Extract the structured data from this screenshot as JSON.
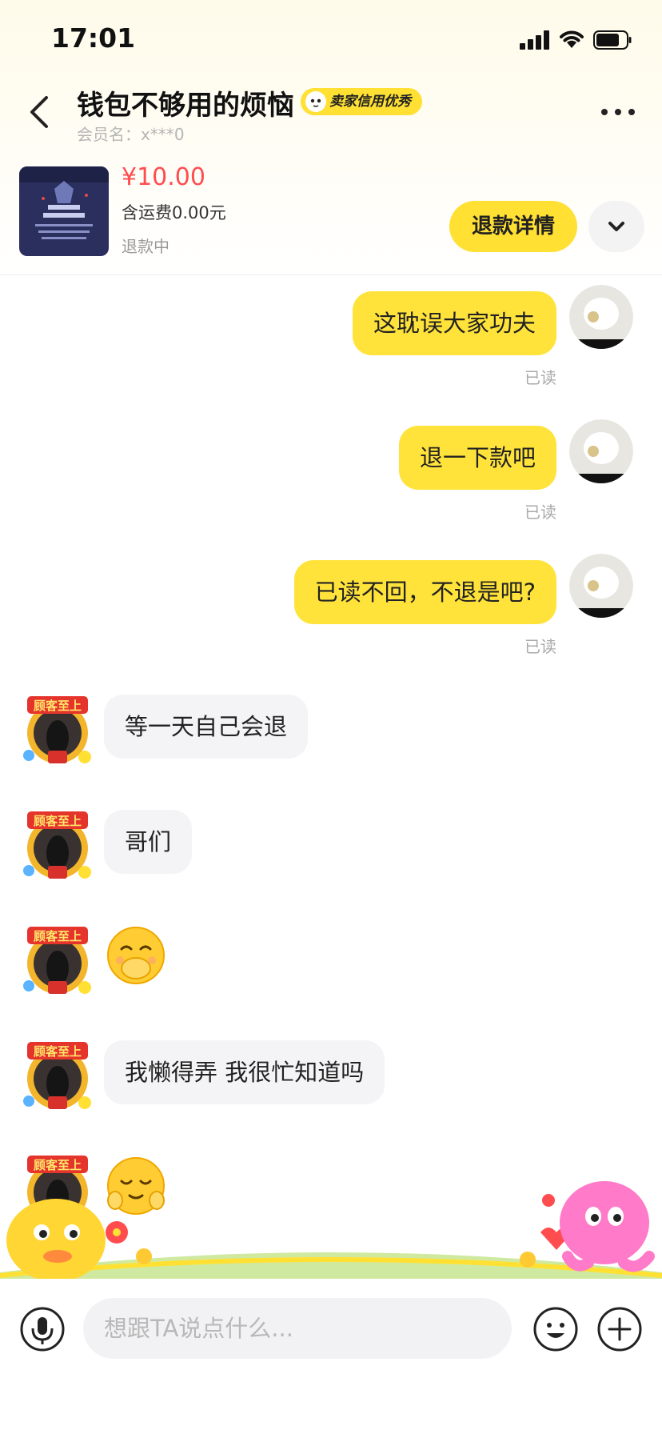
{
  "status_bar": {
    "time": "17:01"
  },
  "header": {
    "title": "钱包不够用的烦恼",
    "seller_badge": "卖家信用优秀",
    "member_label": "会员名：",
    "member_name": "x***0"
  },
  "product": {
    "price": "¥10.00",
    "shipping": "含运费0.00元",
    "status": "退款中",
    "refund_button": "退款详情"
  },
  "messages": {
    "m1": {
      "text": "这耽误大家功夫",
      "status": "已读"
    },
    "m2": {
      "text": "退一下款吧",
      "status": "已读"
    },
    "m3": {
      "text": "已读不回，不退是吧?",
      "status": "已读"
    },
    "m4": {
      "text": "等一天自己会退"
    },
    "m5": {
      "text": "哥们"
    },
    "m6": {
      "emoji": "covering-mouth-smile-emoji"
    },
    "m7": {
      "text": "我懒得弄 我很忙知道吗"
    },
    "m8": {
      "emoji": "shy-smile-emoji"
    }
  },
  "seller_avatar_label": "顾客至上",
  "input": {
    "placeholder": "想跟TA说点什么..."
  },
  "colors": {
    "accent": "#ffe033",
    "price": "#ff4d4f",
    "bubble_them": "#f4f4f6"
  }
}
